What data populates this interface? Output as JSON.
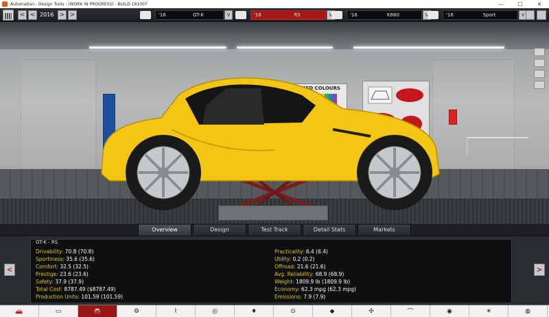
{
  "window": {
    "title": "Automation - Design Tools - (WORK IN PROGRESS) - BUILD 161007",
    "minimize": "—",
    "maximize": "☐",
    "close": "✕"
  },
  "toolbar": {
    "year_prev2": "<",
    "year_prev": "<",
    "year": "2016",
    "year_next": ">",
    "year_next2": ">",
    "slots": [
      {
        "icon": "car-model-icon",
        "year": "'16",
        "name": "GT-K",
        "active": false
      },
      {
        "icon": "car-trim-icon",
        "year": "'16",
        "name": "RS",
        "active": true
      },
      {
        "icon": "engine-icon",
        "year": "'16",
        "name": "K660",
        "active": false
      },
      {
        "icon": "engine-variant-icon",
        "year": "'16",
        "name": "Sport",
        "active": false
      }
    ],
    "dropdown_glyph": "V"
  },
  "scene": {
    "poster_title": "ROPOSED COLOURS"
  },
  "tabs": [
    "Overview",
    "Design",
    "Test Track",
    "Detail Stats",
    "Markets"
  ],
  "active_tab": "Overview",
  "stats": {
    "car_name": "GT-K - RS",
    "left": [
      {
        "label": "Drivability:",
        "value": "70.8 (70.8)"
      },
      {
        "label": "Sportiness:",
        "value": "35.6 (35.6)"
      },
      {
        "label": "Comfort:",
        "value": "32.5 (32.5)"
      },
      {
        "label": "Prestige:",
        "value": "23.6 (23.6)"
      },
      {
        "label": "Safety:",
        "value": "37.9 (37.9)"
      },
      {
        "label": "Total Cost:",
        "value": "8787.49 ($8787.49)"
      },
      {
        "label": "Production Units:",
        "value": "101.59 (101.59)"
      }
    ],
    "right": [
      {
        "label": "Practicality:",
        "value": "6.4 (6.4)"
      },
      {
        "label": "Utility:",
        "value": "0.2 (0.2)"
      },
      {
        "label": "Offroad:",
        "value": "21.6 (21.6)"
      },
      {
        "label": "Avg. Reliability:",
        "value": "68.9 (68.9)"
      },
      {
        "label": "Weight:",
        "value": "1809.9 lb (1809.9 lb)"
      },
      {
        "label": "Economy:",
        "value": "62.3 mpg (62.3 mpg)"
      },
      {
        "label": "Emissions:",
        "value": "7.9 (7.9)"
      }
    ],
    "prev": "<",
    "next": ">"
  },
  "bottom_bar": [
    "car",
    "chassis",
    "car-active",
    "gearbox",
    "suspension",
    "wheels",
    "interior",
    "brakes",
    "body",
    "fan",
    "aero",
    "steering",
    "lights",
    "globe"
  ],
  "colors": {
    "accent_red": "#a41818",
    "stat_label": "#e2c21a",
    "car_yellow": "#f3c613"
  }
}
